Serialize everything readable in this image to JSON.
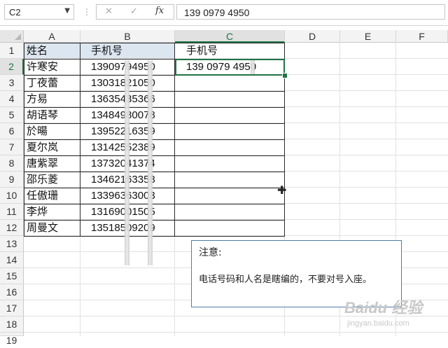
{
  "formula_bar": {
    "name_box": "C2",
    "cancel_icon": "✕",
    "enter_icon": "✓",
    "fx_label": "fx",
    "content": "139 0979 4950"
  },
  "columns": [
    "A",
    "B",
    "C",
    "D",
    "E",
    "F"
  ],
  "selected_column": "C",
  "row_numbers": [
    "1",
    "2",
    "3",
    "4",
    "5",
    "6",
    "7",
    "8",
    "9",
    "10",
    "11",
    "12",
    "13",
    "14",
    "15",
    "16",
    "17",
    "18",
    "19"
  ],
  "selected_row": "2",
  "table": {
    "headers": {
      "a": "姓名",
      "b": "手机号",
      "c": "手机号"
    },
    "rows": [
      {
        "name": "许寒安",
        "phone": "13909794950",
        "c": "139 0979 4950"
      },
      {
        "name": "丁夜蕾",
        "phone": "13031821050",
        "c": ""
      },
      {
        "name": "方易",
        "phone": "13635435366",
        "c": ""
      },
      {
        "name": "胡语琴",
        "phone": "13484980078",
        "c": ""
      },
      {
        "name": "於暘",
        "phone": "13952216359",
        "c": ""
      },
      {
        "name": "夏尔岚",
        "phone": "13142552389",
        "c": ""
      },
      {
        "name": "唐紫翠",
        "phone": "13732041374",
        "c": ""
      },
      {
        "name": "邵乐菱",
        "phone": "13462163358",
        "c": ""
      },
      {
        "name": "任傲珊",
        "phone": "13396363003",
        "c": ""
      },
      {
        "name": "李烨",
        "phone": "13169001505",
        "c": ""
      },
      {
        "name": "周曼文",
        "phone": "13518509209",
        "c": ""
      }
    ]
  },
  "note": {
    "title": "注意:",
    "body": "电话号码和人名是瞎编的，不要对号入座。"
  },
  "watermark": {
    "main": "Baidu 经验",
    "sub": "jingyan.baidu.com"
  },
  "colors": {
    "accent": "#217346",
    "header_fill": "#dce6f1",
    "note_border": "#4f7cab"
  }
}
